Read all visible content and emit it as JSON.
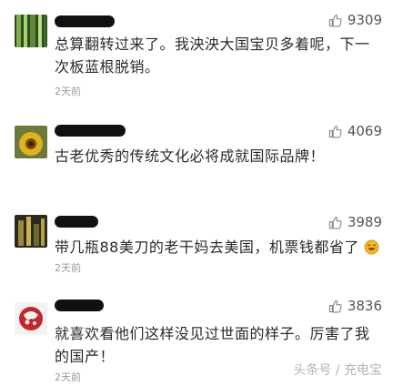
{
  "comments": [
    {
      "likes": "9309",
      "text": "总算翻转过来了。我泱泱大国宝贝多着呢，下一次板蓝根脱销。",
      "time": "2天前"
    },
    {
      "likes": "4069",
      "text": "古老优秀的传统文化必将成就国际品牌！",
      "time": ""
    },
    {
      "likes": "3989",
      "text": "带几瓶88美刀的老干妈去美国，机票钱都省了",
      "time": "2天前"
    },
    {
      "likes": "3836",
      "text": "就喜欢看他们这样没见过世面的样子。厉害了我的国产！",
      "time": "2天前"
    }
  ],
  "watermark": "头条号 / 充电宝",
  "colors": {
    "like_icon": "#8a8a8a",
    "text": "#2a2a2a",
    "time": "#9a9a9a"
  },
  "icons": {
    "like": "thumbs-up-icon",
    "emoji": "laughing-emoji-icon"
  }
}
